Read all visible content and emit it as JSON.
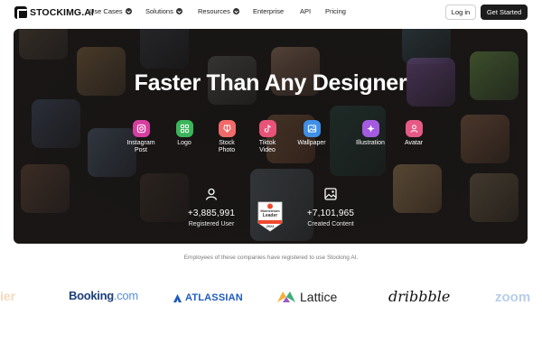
{
  "nav": {
    "brand": "STOCKIMG.AI",
    "items": [
      {
        "label": "Use Cases",
        "dropdown": true
      },
      {
        "label": "Solutions",
        "dropdown": true
      },
      {
        "label": "Resources",
        "dropdown": true
      },
      {
        "label": "Enterprise",
        "dropdown": false
      },
      {
        "label": "API",
        "dropdown": false
      },
      {
        "label": "Pricing",
        "dropdown": false
      }
    ],
    "login": "Log in",
    "get_started": "Get Started"
  },
  "hero": {
    "title": "Faster Than Any Designer",
    "categories": [
      {
        "label": "Instagram\nPost",
        "icon": "instagram-icon",
        "color": "#d63fa0"
      },
      {
        "label": "Logo",
        "icon": "grid-icon",
        "color": "#3bb55a"
      },
      {
        "label": "Stock\nPhoto",
        "icon": "stock-photo-icon",
        "color": "#f06a6a"
      },
      {
        "label": "Tiktok\nVideo",
        "icon": "tiktok-icon",
        "color": "#e8537a"
      },
      {
        "label": "Wallpaper",
        "icon": "wallpaper-icon",
        "color": "#3e8fe6"
      },
      {
        "label": "Illustration",
        "icon": "sparkle-icon",
        "color": "#a45be0"
      },
      {
        "label": "Avatar",
        "icon": "avatar-icon",
        "color": "#e75a86"
      }
    ],
    "stats": [
      {
        "value": "+3,885,991",
        "label": "Registered User",
        "icon": "user-icon"
      },
      {
        "value": "+7,101,965",
        "label": "Created Content",
        "icon": "image-icon"
      }
    ],
    "badge": {
      "top": "Momentum",
      "middle": "Leader",
      "year": "2024",
      "brand_color": "#ef4a2f"
    }
  },
  "trust": {
    "note": "Employees of these companies have registered to use Stocking AI.",
    "partial_left": "ier",
    "booking_main": "Booking",
    "booking_dot": ".com",
    "atlassian": "ATLASSIAN",
    "lattice": "Lattice",
    "dribbble": "dribbble",
    "zoom": "zoom"
  }
}
